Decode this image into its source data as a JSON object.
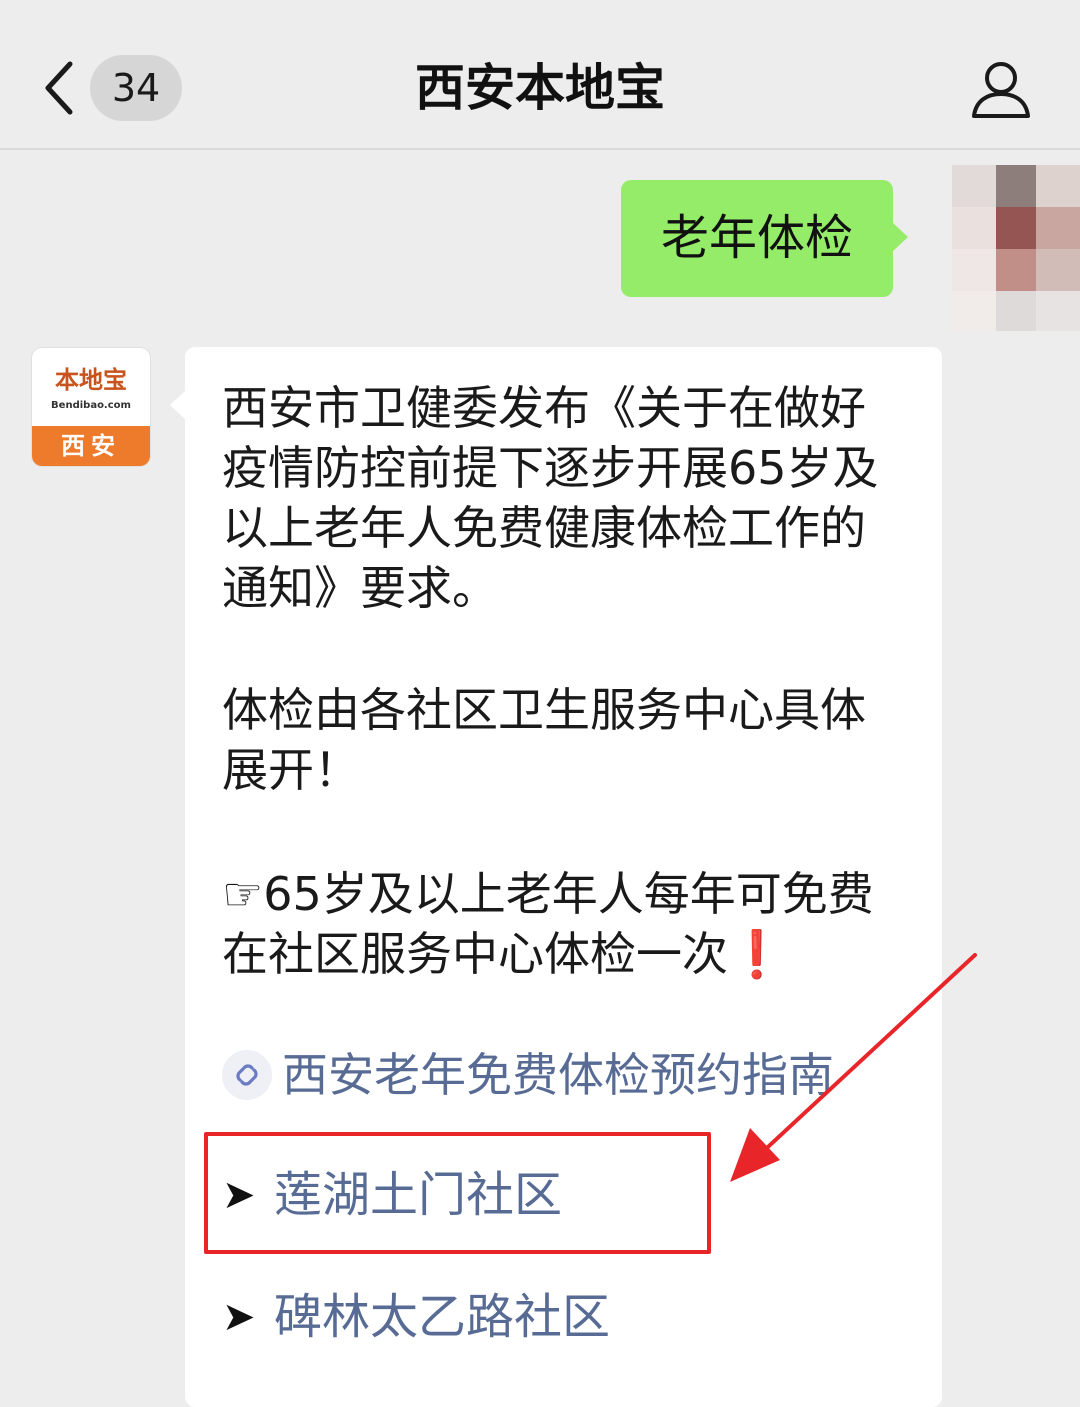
{
  "header": {
    "back_icon": "chevron-left-icon",
    "unread_count": "34",
    "title": "西安本地宝",
    "profile_icon": "person-icon"
  },
  "outgoing": {
    "text": "老年体检"
  },
  "bot": {
    "avatar": {
      "logo_top": "本地宝",
      "logo_url": "Bendibao.com",
      "logo_bottom": "西安"
    },
    "para1": "西安市卫健委发布《关于在做好疫情防控前提下逐步开展65岁及以上老年人免费健康体检工作的通知》要求。",
    "para2": "体检由各社区卫生服务中心具体展开！",
    "para3_main": "☞65岁及以上老年人每年可免费在社区服务中心体检一次",
    "para3_mark": "❗",
    "link_icon": "mini-program-link-icon",
    "link_text": "西安老年免费体检预约指南",
    "communities": [
      {
        "bullet": "➤",
        "name": "莲湖土门社区"
      },
      {
        "bullet": "➤",
        "name": "碑林太乙路社区"
      }
    ]
  },
  "colors": {
    "background": "#ededed",
    "outgoing_bubble": "#95ec69",
    "link": "#576b95",
    "annotation_red": "#e8262a"
  }
}
